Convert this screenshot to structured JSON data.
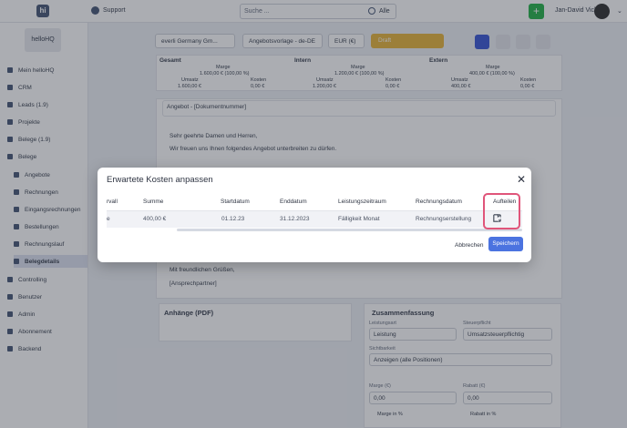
{
  "topbar": {
    "logo": "hi",
    "support": "Support",
    "search_placeholder": "Suche ...",
    "search_scope": "Alle",
    "user_name": "Jan-David Vick"
  },
  "sidebar": {
    "brand": "helloHQ",
    "items": [
      {
        "label": "Mein helloHQ"
      },
      {
        "label": "CRM"
      },
      {
        "label": "Leads (1.9)"
      },
      {
        "label": "Projekte"
      },
      {
        "label": "Belege (1.9)"
      },
      {
        "label": "Belege"
      },
      {
        "label": "Angebote"
      },
      {
        "label": "Rechnungen"
      },
      {
        "label": "Eingangsrechnungen"
      },
      {
        "label": "Bestellungen"
      },
      {
        "label": "Rechnungslauf"
      },
      {
        "label": "Belegdetails"
      },
      {
        "label": "Controlling"
      },
      {
        "label": "Benutzer"
      },
      {
        "label": "Admin"
      },
      {
        "label": "Abonnement"
      },
      {
        "label": "Backend"
      }
    ]
  },
  "doc": {
    "company": "everli Germany Gm...",
    "template": "Angebotsvorlage - de-DE",
    "currency": "EUR (€)",
    "status": "Draft",
    "summary": {
      "gesamt": {
        "title": "Gesamt",
        "marge_label": "Marge",
        "marge": "1.600,00 € (100,00 %)",
        "umsatz_label": "Umsatz",
        "umsatz": "1.600,00 €",
        "kosten_label": "Kosten",
        "kosten": "0,00 €"
      },
      "intern": {
        "title": "Intern",
        "marge_label": "Marge",
        "marge": "1.200,00 € (100,00 %)",
        "umsatz_label": "Umsatz",
        "umsatz": "1.200,00 €",
        "kosten_label": "Kosten",
        "kosten": "0,00 €"
      },
      "extern": {
        "title": "Extern",
        "marge_label": "Marge",
        "marge": "400,00 € (100,00 %)",
        "umsatz_label": "Umsatz",
        "umsatz": "400,00 €",
        "kosten_label": "Kosten",
        "kosten": "0,00 €"
      }
    },
    "heading": "Angebot - [Dokumentnummer]",
    "greeting": "Sehr geehrte Damen und Herren,",
    "intro": "Wir freuen uns Ihnen folgendes Angebot unterbreiten zu dürfen.",
    "closing": "Mit freundlichen Grüßen,",
    "contact": "[Ansprechpartner]",
    "attachments": "Anhänge (PDF)",
    "zusammenfassung": "Zusammenfassung",
    "leistungsart_label": "Leistungsart",
    "leistungsart": "Leistung",
    "steuer_label": "Steuerpflicht",
    "steuer": "Umsatzsteuerpflichtig",
    "positionen_label": "Sichtbarkeit",
    "positionen": "Anzeigen (alle Positionen)",
    "marge_label": "Marge (€)",
    "marge_value": "0,00",
    "rabatt_label": "Rabatt (€)",
    "rabatt_value": "0,00",
    "marge_pct": "Marge in %",
    "rabatt_pct": "Rabatt in %"
  },
  "modal": {
    "title": "Erwartete Kosten anpassen",
    "columns": [
      "rvall",
      "Summe",
      "Startdatum",
      "Enddatum",
      "Leistungszeitraum",
      "Rechnungsdatum",
      "Aufteilen"
    ],
    "row": [
      "e",
      "400,00 €",
      "01.12.23",
      "31.12.2023",
      "Fälligkeit Monat",
      "Rechnungserstellung"
    ],
    "cancel": "Abbrechen",
    "save": "Speichern"
  }
}
